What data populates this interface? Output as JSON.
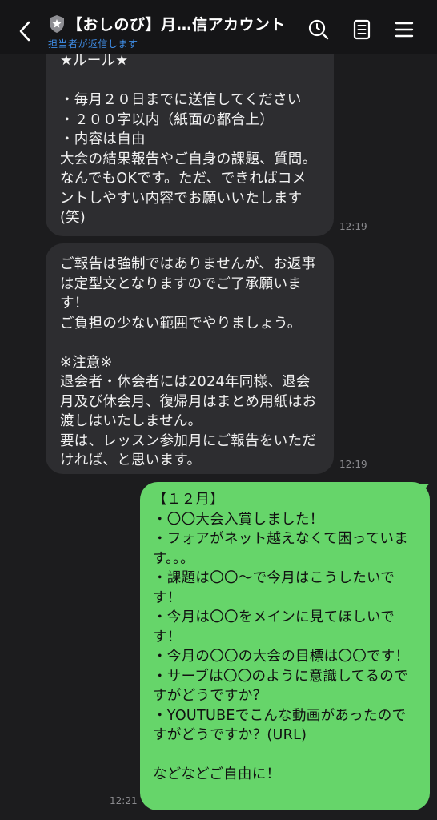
{
  "header": {
    "back_icon": "chevron-left-icon",
    "title": "【おしのび】月…信アカウント",
    "subtitle": "担当者が返信します",
    "search_icon": "search-icon",
    "notes_icon": "notes-icon",
    "menu_icon": "hamburger-menu-icon"
  },
  "messages": [
    {
      "direction": "incoming",
      "text": "★ルール★\n\n・毎月２０日までに送信してください\n・２００字以内（紙面の都合上）\n・内容は自由\n大会の結果報告やご自身の課題、質問。なんでもOKです。ただ、できればコメントしやすい内容でお願いいたします(笑)",
      "time": "12:19"
    },
    {
      "direction": "incoming",
      "text": "ご報告は強制ではありませんが、お返事は定型文となりますのでご了承願います！\nご負担の少ない範囲でやりましょう。\n\n※注意※\n退会者・休会者には2024年同様、退会月及び休会月、復帰月はまとめ用紙はお渡しはいたしません。\n要は、レッスン参加月にご報告をいただければ、と思います。",
      "time": "12:19"
    },
    {
      "direction": "outgoing",
      "text": "【１２月】\n・〇〇大会入賞しました！\n・フォアがネット越えなくて困っています。。。\n・課題は〇〇〜で今月はこうしたいです！\n・今月は〇〇をメインに見てほしいです！\n・今月の〇〇の大会の目標は〇〇です！\n・サーブは〇〇のように意識してるのですがどうですか？\n・YOUTUBEでこんな動画があったのですがどうですか？(URL)\n\nなどなどご自由に！",
      "time": "12:21"
    }
  ],
  "colors": {
    "background": "#1c1c1e",
    "header_bg": "#151517",
    "incoming_bubble": "#2d2d30",
    "outgoing_bubble": "#66d56a",
    "subtitle": "#3f8de6"
  }
}
